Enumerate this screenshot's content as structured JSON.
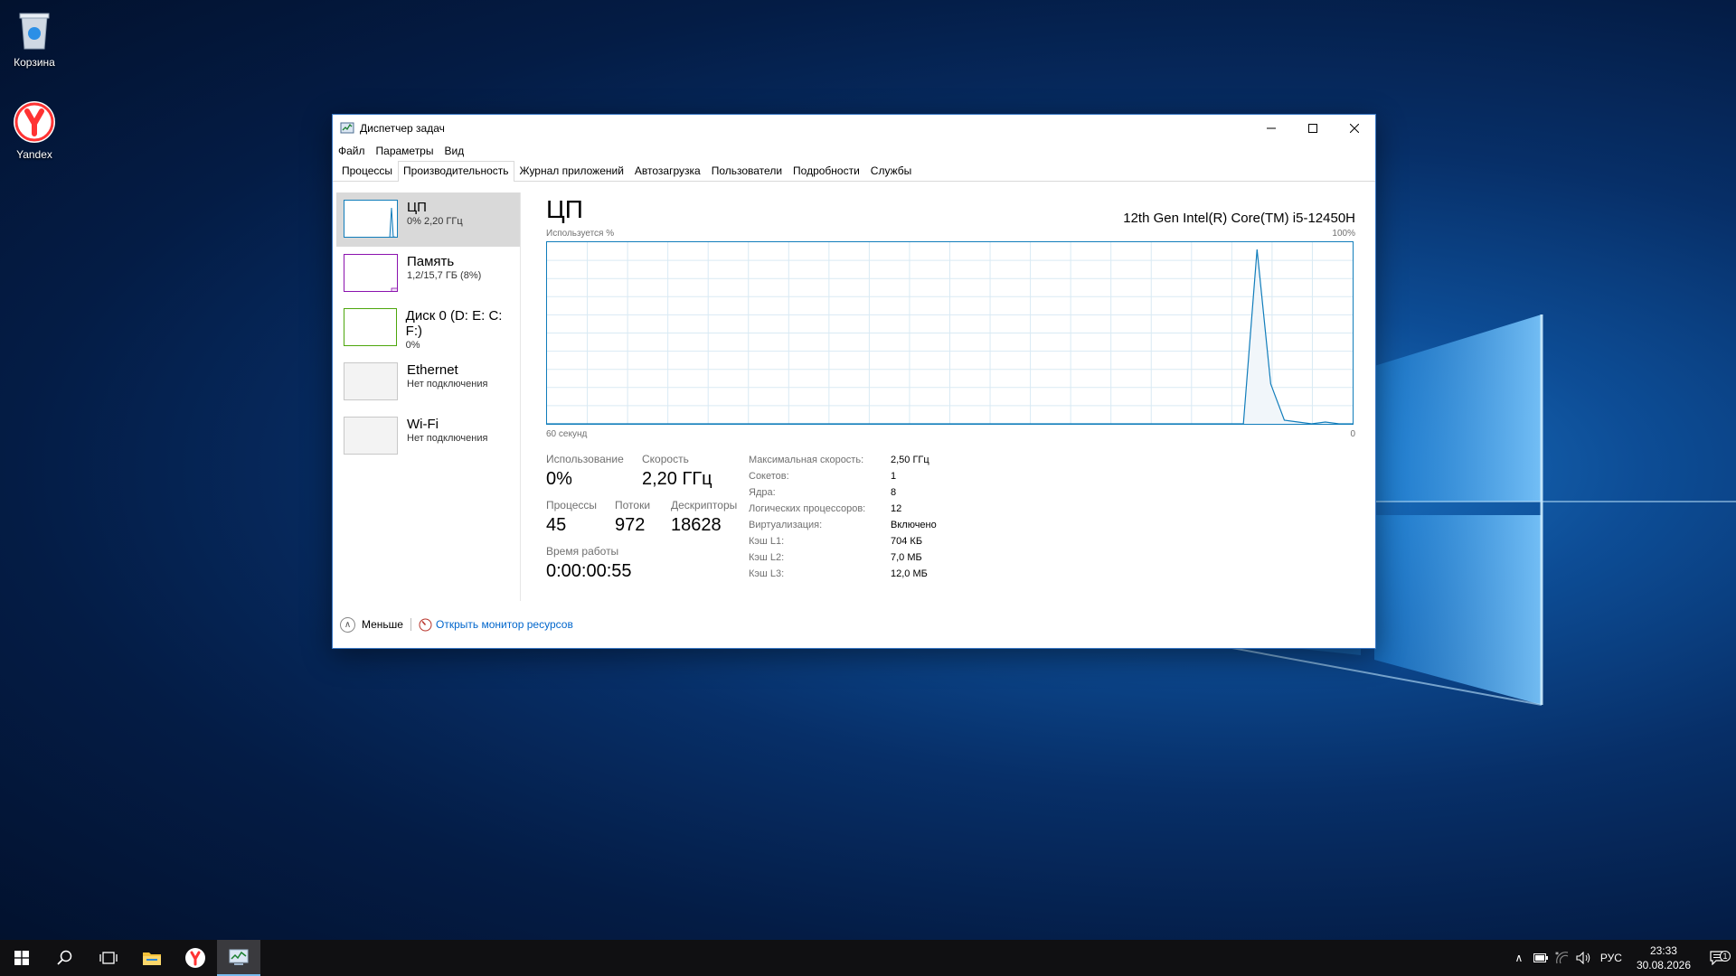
{
  "desktop": {
    "icons": [
      {
        "label": "Корзина"
      },
      {
        "label": "Yandex"
      }
    ]
  },
  "window": {
    "title": "Диспетчер задач",
    "menu": [
      "Файл",
      "Параметры",
      "Вид"
    ],
    "tabs": [
      "Процессы",
      "Производительность",
      "Журнал приложений",
      "Автозагрузка",
      "Пользователи",
      "Подробности",
      "Службы"
    ],
    "active_tab": "Производительность"
  },
  "sidebar": {
    "items": [
      {
        "name": "ЦП",
        "sub": "0% 2,20 ГГц",
        "color": "#117dbb"
      },
      {
        "name": "Память",
        "sub": "1,2/15,7 ГБ (8%)",
        "color": "#8b12ae"
      },
      {
        "name": "Диск 0 (D: E: C: F:)",
        "sub": "0%",
        "color": "#4da60c"
      },
      {
        "name": "Ethernet",
        "sub": "Нет подключения",
        "color": "#bbbbbb"
      },
      {
        "name": "Wi-Fi",
        "sub": "Нет подключения",
        "color": "#bbbbbb"
      }
    ]
  },
  "cpu": {
    "title": "ЦП",
    "model": "12th Gen Intel(R) Core(TM) i5-12450H",
    "graph_label_left": "Используется %",
    "graph_label_right": "100%",
    "graph_time": "60 секунд",
    "graph_min": "0",
    "usage_label": "Использование",
    "usage_value": "0%",
    "speed_label": "Скорость",
    "speed_value": "2,20 ГГц",
    "processes_label": "Процессы",
    "processes_value": "45",
    "threads_label": "Потоки",
    "threads_value": "972",
    "handles_label": "Дескрипторы",
    "handles_value": "18628",
    "uptime_label": "Время работы",
    "uptime_value": "0:00:00:55",
    "specs": [
      {
        "k": "Максимальная скорость:",
        "v": "2,50 ГГц"
      },
      {
        "k": "Сокетов:",
        "v": "1"
      },
      {
        "k": "Ядра:",
        "v": "8"
      },
      {
        "k": "Логических процессоров:",
        "v": "12"
      },
      {
        "k": "Виртуализация:",
        "v": "Включено"
      },
      {
        "k": "Кэш L1:",
        "v": "704 КБ"
      },
      {
        "k": "Кэш L2:",
        "v": "7,0 МБ"
      },
      {
        "k": "Кэш L3:",
        "v": "12,0 МБ"
      }
    ],
    "usage_history": [
      0,
      0,
      0,
      0,
      0,
      0,
      0,
      0,
      0,
      0,
      0,
      0,
      0,
      0,
      0,
      0,
      0,
      0,
      0,
      0,
      0,
      0,
      0,
      0,
      0,
      0,
      0,
      0,
      0,
      0,
      0,
      0,
      0,
      0,
      0,
      0,
      0,
      0,
      0,
      0,
      0,
      0,
      0,
      0,
      0,
      0,
      0,
      0,
      0,
      0,
      0,
      0,
      96,
      22,
      2,
      1,
      0,
      1,
      0,
      0
    ]
  },
  "footer": {
    "less": "Меньше",
    "resmon": "Открыть монитор ресурсов"
  },
  "taskbar": {
    "lang": "РУС",
    "time": "23:33",
    "date": "30.08.2026",
    "notif_count": "1"
  }
}
